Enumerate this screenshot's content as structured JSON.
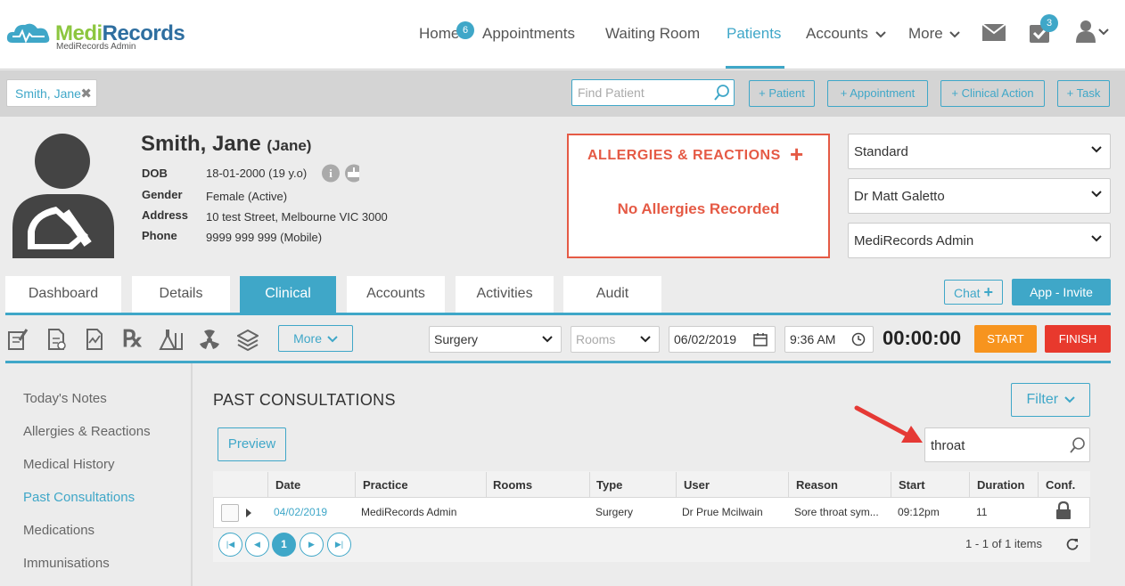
{
  "brand": {
    "name_medi": "Medi",
    "name_records": "Records",
    "subtitle": "MediRecords Admin"
  },
  "nav": {
    "home": "Home",
    "home_badge": "6",
    "appointments": "Appointments",
    "waiting_room": "Waiting Room",
    "patients": "Patients",
    "accounts": "Accounts",
    "more": "More",
    "tasks_badge": "3"
  },
  "patient_tab": {
    "label": "Smith, Jane"
  },
  "quick": {
    "find_placeholder": "Find Patient",
    "patient": "+ Patient",
    "appointment": "+ Appointment",
    "clinical_action": "+ Clinical Action",
    "task": "+ Task"
  },
  "patient": {
    "name": "Smith, Jane",
    "preferred": "(Jane)",
    "dob_label": "DOB",
    "dob": "18-01-2000 (19 y.o)",
    "gender_label": "Gender",
    "gender": "Female (Active)",
    "address_label": "Address",
    "address": "10 test Street, Melbourne VIC 3000",
    "phone_label": "Phone",
    "phone": "9999 999 999 (Mobile)"
  },
  "allergies": {
    "title": "ALLERGIES & REACTIONS",
    "add": "+",
    "none": "No Allergies Recorded"
  },
  "selectors": {
    "fee": "Standard",
    "doctor": "Dr Matt Galetto",
    "practice": "MediRecords Admin"
  },
  "tabs": [
    "Dashboard",
    "Details",
    "Clinical",
    "Accounts",
    "Activities",
    "Audit"
  ],
  "chat": {
    "label": "Chat"
  },
  "invite": {
    "label": "App - Invite"
  },
  "toolbar": {
    "more": "More",
    "location": "Surgery",
    "rooms_placeholder": "Rooms",
    "date": "06/02/2019",
    "time": "9:36 AM",
    "timer": "00:00:00",
    "start": "START",
    "finish": "FINISH"
  },
  "sidebar": [
    "Today's Notes",
    "Allergies & Reactions",
    "Medical History",
    "Past Consultations",
    "Medications",
    "Immunisations"
  ],
  "consultations": {
    "title": "PAST CONSULTATIONS",
    "filter": "Filter",
    "search_value": "throat",
    "preview": "Preview",
    "columns": [
      "Date",
      "Practice",
      "Rooms",
      "Type",
      "User",
      "Reason",
      "Start",
      "Duration",
      "Conf."
    ],
    "rows": [
      {
        "date": "04/02/2019",
        "practice": "MediRecords Admin",
        "rooms": "",
        "type": "Surgery",
        "user": "Dr Prue Mcilwain",
        "reason": "Sore throat sym...",
        "start": "09:12pm",
        "duration": "11"
      }
    ],
    "page": "1",
    "items_summary": "1 - 1 of 1 items"
  }
}
